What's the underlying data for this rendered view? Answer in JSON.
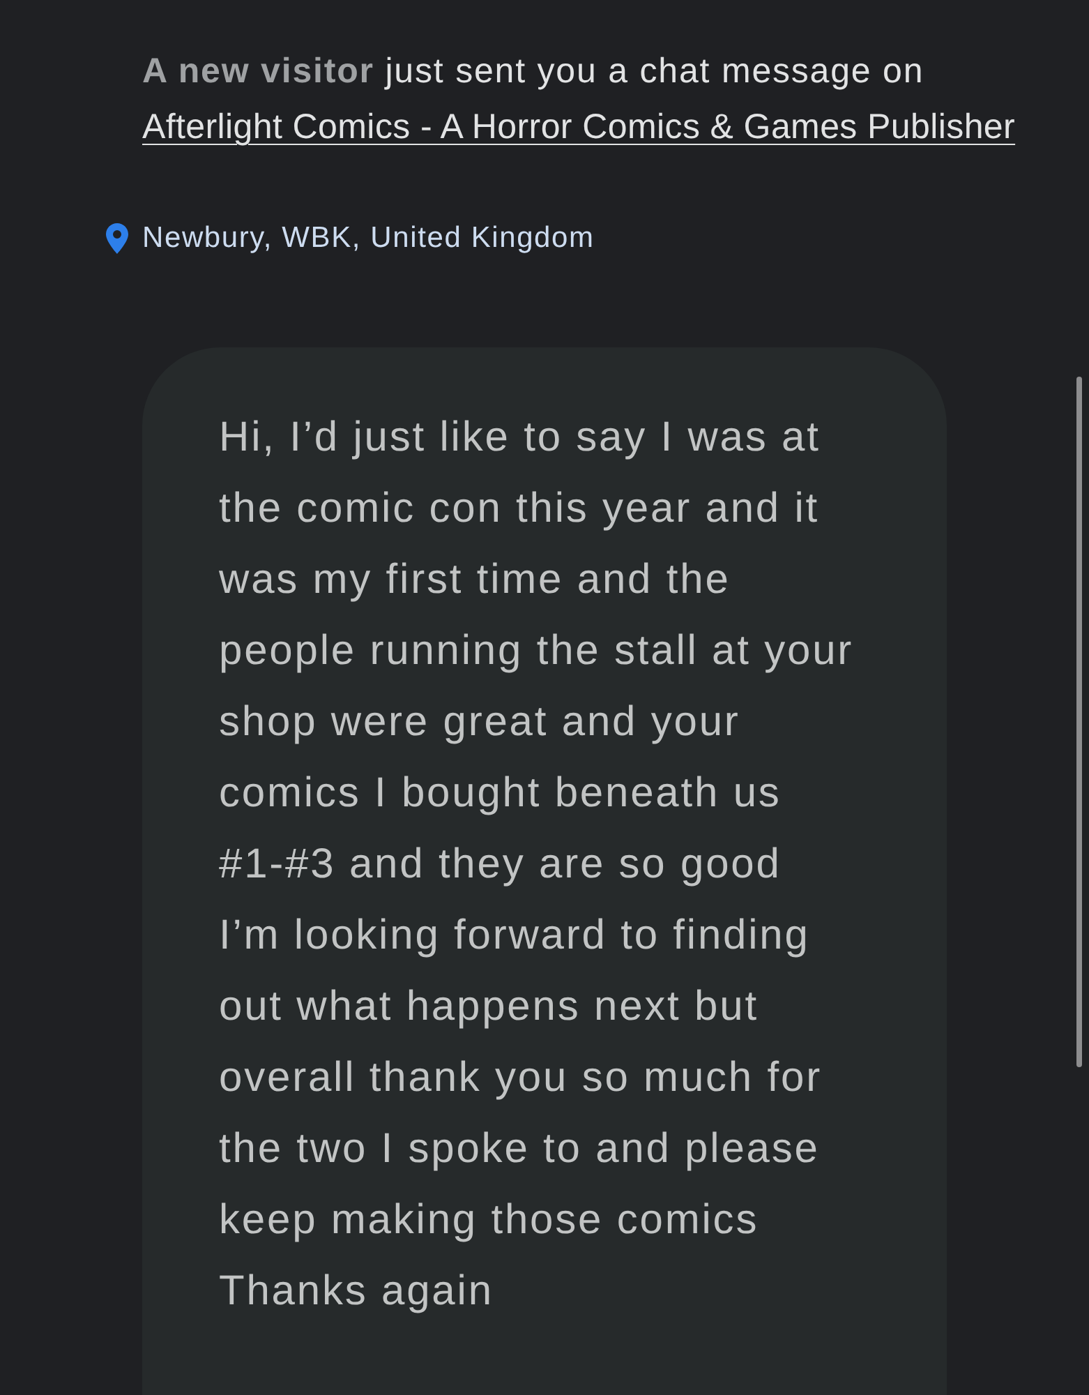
{
  "notice": {
    "text": "**A new visitor** just sent you a chat message on",
    "link": "Afterlight Comics - A Horror Comics & Games Publisher"
  },
  "location": {
    "text": "Newbury, WBK, United Kingdom"
  },
  "message": {
    "text": "Hi, I’d just like to say I was at\nthe comic con this year and it\nwas my first time and the\npeople running the stall at your\nshop were great and your\ncomics I bought beneath us\n#1-#3 and they are so good\nI’m looking forward to finding\nout what happens next but\noverall thank you so much for\nthe two I spoke to and please\nkeep making those comics\nThanks again"
  }
}
